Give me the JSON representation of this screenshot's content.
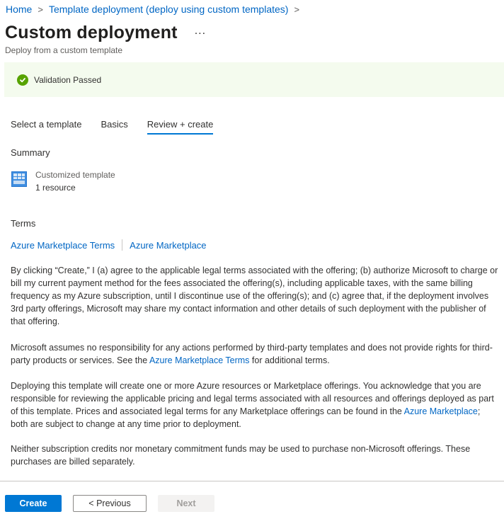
{
  "breadcrumb": {
    "items": [
      "Home",
      "Template deployment (deploy using custom templates)"
    ],
    "separator": ">"
  },
  "header": {
    "title": "Custom deployment",
    "more_label": "...",
    "subtitle": "Deploy from a custom template"
  },
  "banner": {
    "message": "Validation Passed",
    "icon": "check-circle-icon",
    "color": "#57a300",
    "background": "#f4fbee"
  },
  "tabs": [
    {
      "label": "Select a template",
      "active": false
    },
    {
      "label": "Basics",
      "active": false
    },
    {
      "label": "Review + create",
      "active": true
    }
  ],
  "summary": {
    "heading": "Summary",
    "item_name": "Customized template",
    "item_detail": "1 resource",
    "item_icon": "template-icon"
  },
  "terms": {
    "heading": "Terms",
    "links": [
      "Azure Marketplace Terms",
      "Azure Marketplace"
    ],
    "paragraph1": "By clicking “Create,” I (a) agree to the applicable legal terms associated with the offering; (b) authorize Microsoft to charge or bill my current payment method for the fees associated the offering(s), including applicable taxes, with the same billing frequency as my Azure subscription, until I discontinue use of the offering(s); and (c) agree that, if the deployment involves 3rd party offerings, Microsoft may share my contact information and other details of such deployment with the publisher of that offering.",
    "paragraph2_before": "Microsoft assumes no responsibility for any actions performed by third-party templates and does not provide rights for third-party products or services. See the ",
    "paragraph2_link": "Azure Marketplace Terms",
    "paragraph2_after": " for additional terms.",
    "paragraph3_before": "Deploying this template will create one or more Azure resources or Marketplace offerings.  You acknowledge that you are responsible for reviewing the applicable pricing and legal terms associated with all resources and offerings deployed as part of this template.  Prices and associated legal terms for any Marketplace offerings can be found in the ",
    "paragraph3_link": "Azure Marketplace",
    "paragraph3_after": "; both are subject to change at any time prior to deployment.",
    "paragraph4": "Neither subscription credits nor monetary commitment funds may be used to purchase non-Microsoft offerings. These purchases are billed separately."
  },
  "footer": {
    "create_label": "Create",
    "previous_label": "< Previous",
    "next_label": "Next",
    "accent": "#0078d4"
  }
}
